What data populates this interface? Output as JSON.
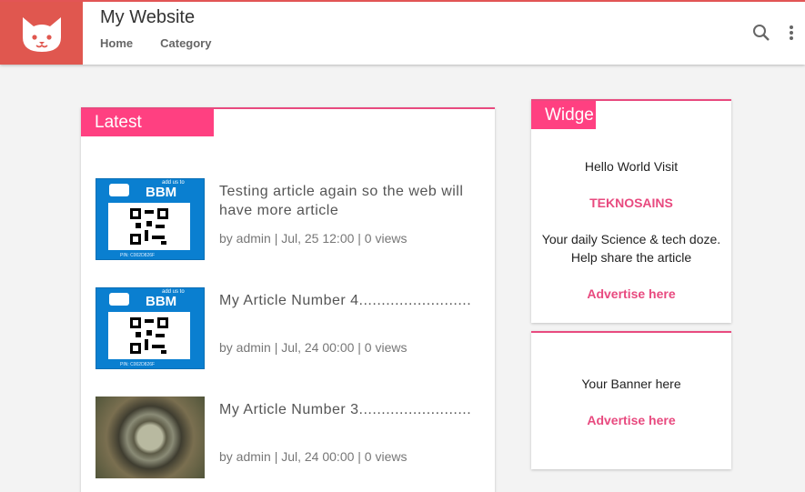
{
  "header": {
    "site_title": "My Website",
    "nav": [
      "Home",
      "Category"
    ],
    "icons": [
      "cat-logo-icon",
      "search-icon",
      "more-vert-icon"
    ],
    "accent": "#e0574f"
  },
  "latest": {
    "label": "Latest",
    "posts": [
      {
        "title": "Testing article again so the web will have more article",
        "meta": "by admin | Jul, 25 12:00 | 0 views",
        "thumb": "bbm",
        "bbm_add": "add us to",
        "bbm_word": "BBM",
        "bbm_pin": "PIN: C002D826F"
      },
      {
        "title": "My Article Number 4.........................",
        "meta": "by admin | Jul, 24 00:00 | 0 views",
        "thumb": "bbm",
        "bbm_add": "add us to",
        "bbm_word": "BBM",
        "bbm_pin": "PIN: C002D826F"
      },
      {
        "title": "My Article Number 3.........................",
        "meta": "by admin | Jul, 24 00:00 | 0 views",
        "thumb": "photo"
      }
    ]
  },
  "widgets": {
    "widget1": {
      "label": "Widge",
      "line1": "Hello World Visit",
      "link": "TEKNOSAINS",
      "description": "Your daily Science & tech doze. Help share the article",
      "advertise": "Advertise here"
    },
    "widget2": {
      "banner": "Your Banner here",
      "advertise": "Advertise here"
    },
    "accent": "#ff4081"
  }
}
